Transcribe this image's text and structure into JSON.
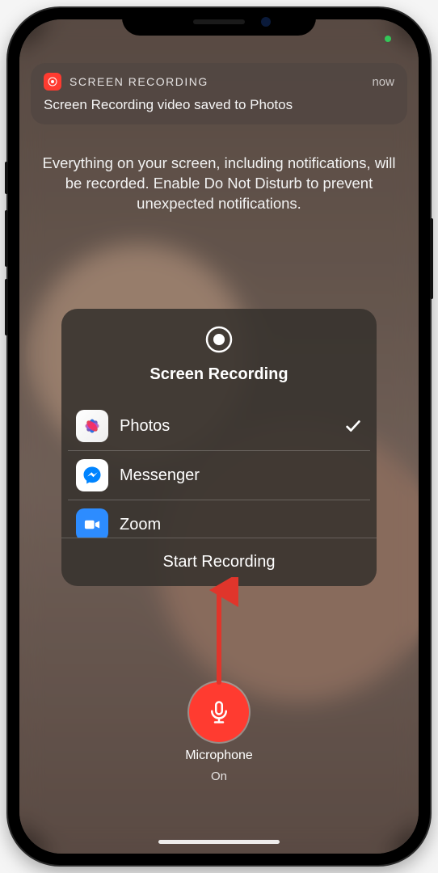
{
  "notification": {
    "app_name": "SCREEN RECORDING",
    "timestamp": "now",
    "message": "Screen Recording video saved to Photos"
  },
  "instruction_text": "Everything on your screen, including notifications, will be recorded. Enable Do Not Disturb to prevent unexpected notifications.",
  "recorder": {
    "title": "Screen Recording",
    "options": {
      "photos": {
        "label": "Photos",
        "selected": true
      },
      "messenger": {
        "label": "Messenger",
        "selected": false
      },
      "zoom": {
        "label": "Zoom",
        "selected": false
      }
    },
    "start_label": "Start Recording"
  },
  "microphone": {
    "label": "Microphone",
    "state": "On",
    "color": "#ff3b30"
  }
}
